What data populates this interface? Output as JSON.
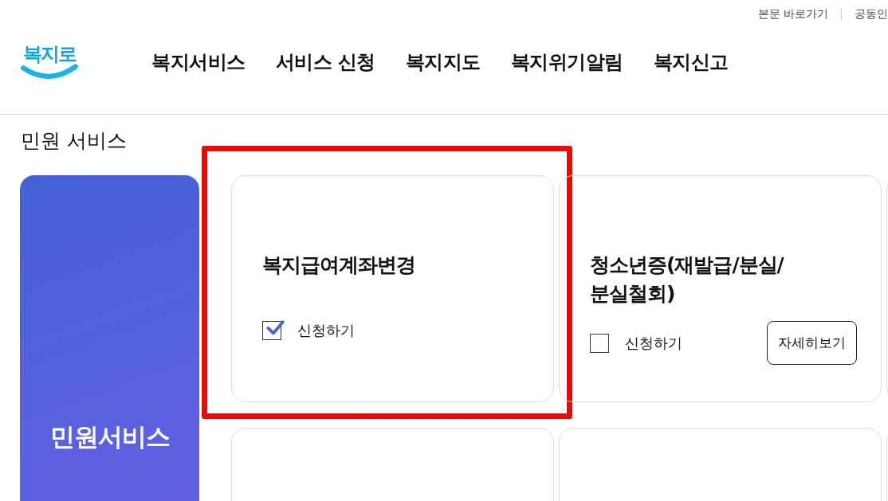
{
  "utility_links": [
    "본문 바로가기",
    "공동인"
  ],
  "logo": "복지로",
  "nav": [
    "복지서비스",
    "서비스 신청",
    "복지지도",
    "복지위기알림",
    "복지신고"
  ],
  "section_title": "민원 서비스",
  "sidebar": {
    "label": "민원서비스"
  },
  "cards": [
    {
      "kind": "service",
      "title": "복지급여계좌변경",
      "checkbox": {
        "label": "신청하기",
        "checked": true
      },
      "highlighted": true
    },
    {
      "kind": "service",
      "title": "청소년증(재발급/분실/분실철회)",
      "checkbox": {
        "label": "신청하기",
        "checked": false
      },
      "detail_button": "자세히보기",
      "highlighted": false
    },
    {
      "kind": "empty"
    },
    {
      "kind": "empty"
    },
    {
      "kind": "empty"
    },
    {
      "kind": "empty"
    }
  ]
}
